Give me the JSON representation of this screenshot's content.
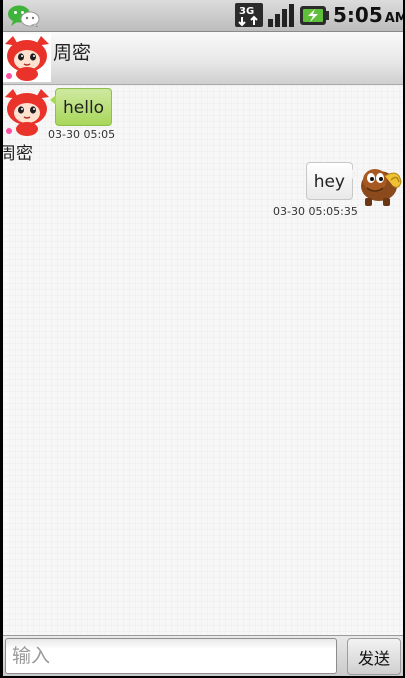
{
  "status_bar": {
    "network_label": "3G",
    "time": "5:05",
    "ampm": "AM"
  },
  "chat_header": {
    "contact_name": "周密"
  },
  "messages": [
    {
      "direction": "received",
      "sender_name": "周密",
      "text": "hello",
      "timestamp": "03-30 05:05"
    },
    {
      "direction": "sent",
      "text": "hey",
      "timestamp": "03-30 05:05:35"
    }
  ],
  "composer": {
    "input_placeholder": "输入",
    "input_value": "",
    "send_label": "发送"
  },
  "colors": {
    "received_bubble": "#a8d75a",
    "sent_bubble": "#f2f2f2",
    "avatar_red": "#e8322a"
  }
}
